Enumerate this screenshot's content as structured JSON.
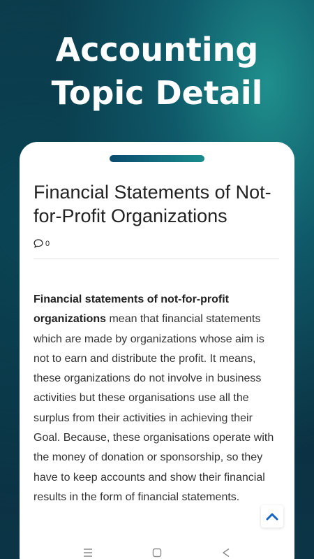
{
  "promo": {
    "line1": "Accounting",
    "line2": "Topic Detail"
  },
  "article": {
    "title": "Financial Statements of Not-for-Profit Organizations",
    "comment_count": "0",
    "body_bold": "Financial statements of not-for-profit organizations",
    "body_rest": " mean that financial statements which are made by organizations whose aim is not to earn and distribute the profit. It means, these organizations do not involve in business activities but these organisations use all the surplus from their activities in achieving their Goal. Because, these organisations operate with the money of donation or sponsorship, so they have to keep accounts and show their financial results in the form of financial statements."
  },
  "icons": {
    "comment": "comment-icon",
    "scroll_top": "chevron-up-icon",
    "recents": "recents-icon",
    "home": "home-icon",
    "back": "back-icon"
  },
  "colors": {
    "accent": "#1565c0",
    "bar_start": "#0b4b6e",
    "bar_end": "#1a8c8c"
  }
}
